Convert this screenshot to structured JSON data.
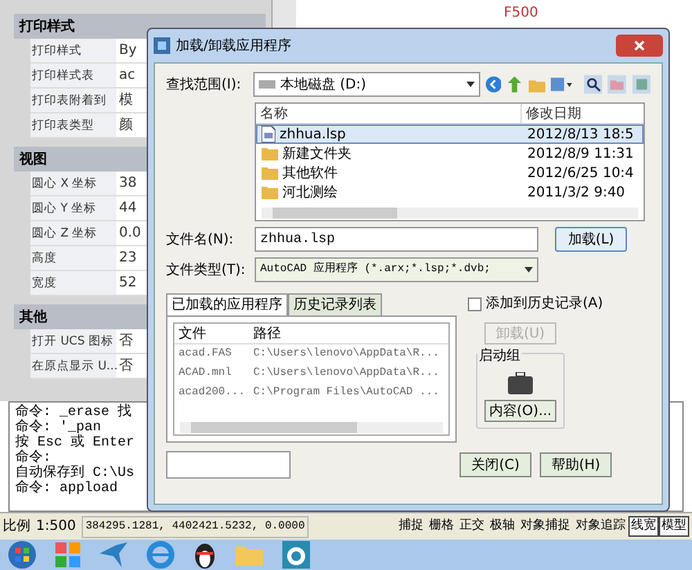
{
  "properties": {
    "sections": [
      {
        "title": "打印样式",
        "rows": [
          {
            "label": "打印样式",
            "value": "By"
          },
          {
            "label": "打印样式表",
            "value": "ac"
          },
          {
            "label": "打印表附着到",
            "value": "模"
          },
          {
            "label": "打印表类型",
            "value": "颜"
          }
        ]
      },
      {
        "title": "视图",
        "rows": [
          {
            "label": "圆心 X 坐标",
            "value": "38"
          },
          {
            "label": "圆心 Y 坐标",
            "value": "44"
          },
          {
            "label": "圆心 Z 坐标",
            "value": "0.0"
          },
          {
            "label": "高度",
            "value": "23"
          },
          {
            "label": "宽度",
            "value": "52"
          }
        ]
      },
      {
        "title": "其他",
        "rows": [
          {
            "label": "打开 UCS 图标",
            "value": "否"
          },
          {
            "label": "在原点显示 U...",
            "value": "否"
          }
        ]
      }
    ]
  },
  "canvas_label": "F500",
  "dialog": {
    "title": "加载/卸载应用程序",
    "look_in_label": "查找范围(I):",
    "look_in": "本地磁盘 (D:)",
    "file_columns": [
      "名称",
      "修改日期"
    ],
    "files": [
      {
        "name": "zhhua.lsp",
        "date": "2012/8/13 18:5",
        "kind": "file",
        "selected": true
      },
      {
        "name": "新建文件夹",
        "date": "2012/8/9 11:31",
        "kind": "folder",
        "selected": false
      },
      {
        "name": "其他软件",
        "date": "2012/6/25 10:4",
        "kind": "folder",
        "selected": false
      },
      {
        "name": "河北测绘",
        "date": "2011/3/2 9:40",
        "kind": "folder",
        "selected": false
      }
    ],
    "file_name_label": "文件名(N):",
    "file_name": "zhhua.lsp",
    "load_button": "加载(L)",
    "file_type_label": "文件类型(T):",
    "file_type": "AutoCAD 应用程序 (*.arx;*.lsp;*.dvb;",
    "tabs": [
      {
        "label": "已加载的应用程序",
        "selected": true
      },
      {
        "label": "历史记录列表",
        "selected": false
      }
    ],
    "app_columns": [
      "文件",
      "路径"
    ],
    "apps": [
      {
        "file": "acad.FAS",
        "path": "C:\\Users\\lenovo\\AppData\\R..."
      },
      {
        "file": "ACAD.mnl",
        "path": "C:\\Users\\lenovo\\AppData\\R..."
      },
      {
        "file": "acad200...",
        "path": "C:\\Program Files\\AutoCAD ..."
      }
    ],
    "add_history": {
      "label": "添加到历史记录(A)",
      "checked": false
    },
    "unload_button": {
      "label": "卸载(U)",
      "disabled": true
    },
    "startup_group": {
      "title": "启动组",
      "button": "内容(O)..."
    },
    "close_button": "关闭(C)",
    "help_button": "帮助(H)"
  },
  "command_lines": [
    "命令: _erase 找",
    "命令: '_pan",
    "按 Esc 或 Enter",
    "命令:",
    "自动保存到 C:\\Us",
    "命令: appload"
  ],
  "status": {
    "scale_label": "比例",
    "scale": "1:500",
    "coords": "384295.1281, 4402421.5232, 0.0000",
    "toggles": [
      {
        "label": "捕捉",
        "on": false
      },
      {
        "label": "栅格",
        "on": false
      },
      {
        "label": "正交",
        "on": false
      },
      {
        "label": "极轴",
        "on": false
      },
      {
        "label": "对象捕捉",
        "on": false
      },
      {
        "label": "对象追踪",
        "on": false
      },
      {
        "label": "线宽",
        "on": true
      },
      {
        "label": "模型",
        "on": true
      }
    ]
  }
}
